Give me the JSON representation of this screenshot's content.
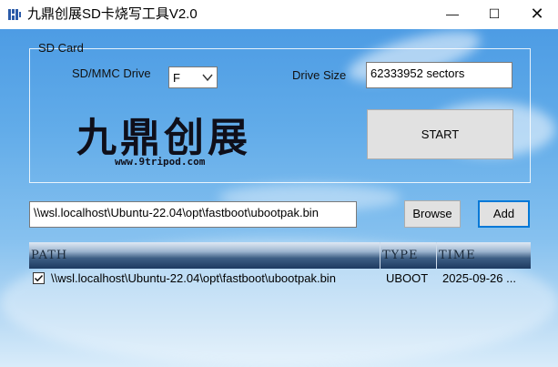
{
  "window": {
    "title": "九鼎创展SD卡烧写工具V2.0",
    "minimize_symbol": "—",
    "maximize_symbol": "☐",
    "close_symbol": "✕"
  },
  "sd_card": {
    "group_label": "SD Card",
    "drive_label": "SD/MMC Drive",
    "drive_value": "F",
    "size_label": "Drive Size",
    "size_value": "62333952 sectors",
    "start_label": "START"
  },
  "logo": {
    "name": "九鼎创展",
    "url": "www.9tripod.com"
  },
  "file": {
    "path_value": "\\\\wsl.localhost\\Ubuntu-22.04\\opt\\fastboot\\ubootpak.bin",
    "browse_label": "Browse",
    "add_label": "Add"
  },
  "list": {
    "columns": [
      "PATH",
      "TYPE",
      "TIME"
    ],
    "rows": [
      {
        "checked": true,
        "path": "\\\\wsl.localhost\\Ubuntu-22.04\\opt\\fastboot\\ubootpak.bin",
        "type": "UBOOT",
        "time": "2025-09-26 ..."
      }
    ]
  },
  "icons": [
    "app-icon",
    "chevron-down-icon",
    "checkmark-icon"
  ]
}
